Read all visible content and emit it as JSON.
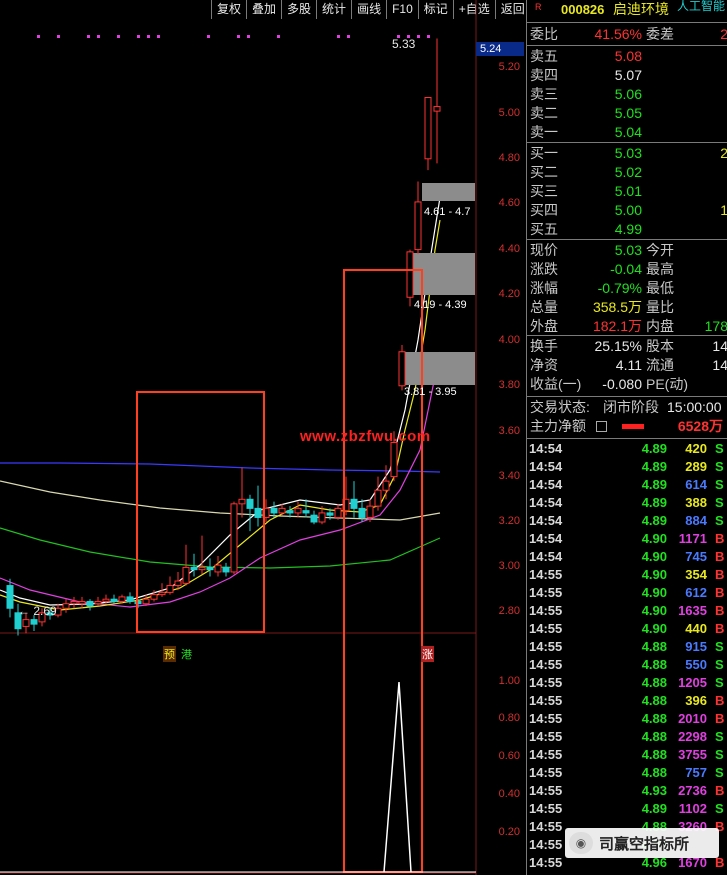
{
  "toolbar": {
    "items": [
      "复权",
      "叠加",
      "多股",
      "统计",
      "画线",
      "F10",
      "标记",
      "+自选",
      "返回"
    ]
  },
  "stock": {
    "flag": "R",
    "code": "000826",
    "name": "启迪环境",
    "extra": "人工智能"
  },
  "price_axis": {
    "current": "5.24",
    "ticks": [
      "5.20",
      "5.00",
      "4.80",
      "4.60",
      "4.40",
      "4.20",
      "4.00",
      "3.80",
      "3.60",
      "3.40",
      "3.20",
      "3.00",
      "2.80"
    ],
    "sub_ticks": [
      "1.00",
      "0.80",
      "0.60",
      "0.40",
      "0.20"
    ]
  },
  "chart_labels": {
    "high_mark": "5.33",
    "low_mark": "2.69",
    "range1": "4.61 - 4.7",
    "range2": "4.19 - 4.39",
    "range3": "3.81 - 3.95",
    "tag1": "预",
    "tag2": "港",
    "tag3": "涨",
    "site_watermark": "www.zbzfwu.com"
  },
  "quote": {
    "weibi_label": "委比",
    "weibi": "41.56%",
    "weicha_label": "委差",
    "weicha": "2",
    "asks": [
      {
        "label": "卖五",
        "price": "5.08",
        "vol": ""
      },
      {
        "label": "卖四",
        "price": "5.07",
        "vol": ""
      },
      {
        "label": "卖三",
        "price": "5.06",
        "vol": ""
      },
      {
        "label": "卖二",
        "price": "5.05",
        "vol": ""
      },
      {
        "label": "卖一",
        "price": "5.04",
        "vol": ""
      }
    ],
    "bids": [
      {
        "label": "买一",
        "price": "5.03",
        "vol": "2"
      },
      {
        "label": "买二",
        "price": "5.02",
        "vol": ""
      },
      {
        "label": "买三",
        "price": "5.01",
        "vol": ""
      },
      {
        "label": "买四",
        "price": "5.00",
        "vol": "1"
      },
      {
        "label": "买五",
        "price": "4.99",
        "vol": ""
      }
    ],
    "stats": [
      {
        "l1": "现价",
        "v1": "5.03",
        "l2": "今开",
        "v2": ""
      },
      {
        "l1": "涨跌",
        "v1": "-0.04",
        "l2": "最高",
        "v2": ""
      },
      {
        "l1": "涨幅",
        "v1": "-0.79%",
        "l2": "最低",
        "v2": ""
      },
      {
        "l1": "总量",
        "v1": "358.5万",
        "l2": "量比",
        "v2": ""
      },
      {
        "l1": "外盘",
        "v1": "182.1万",
        "l2": "内盘",
        "v2": "178"
      }
    ],
    "stats2": [
      {
        "l1": "换手",
        "v1": "25.15%",
        "l2": "股本",
        "v2": "14"
      },
      {
        "l1": "净资",
        "v1": "4.11",
        "l2": "流通",
        "v2": "14"
      },
      {
        "l1": "收益(一)",
        "v1": "-0.080",
        "l2": "PE(动)",
        "v2": ""
      }
    ],
    "status_label": "交易状态:",
    "status_value": "闭市阶段",
    "status_time": "15:00:00",
    "main_net_label": "主力净额",
    "main_net_value": "6528万"
  },
  "trades": [
    {
      "time": "14:54",
      "price": "4.89",
      "vol": "420",
      "dir": "S"
    },
    {
      "time": "14:54",
      "price": "4.89",
      "vol": "289",
      "dir": "S"
    },
    {
      "time": "14:54",
      "price": "4.89",
      "vol": "614",
      "dir": "S"
    },
    {
      "time": "14:54",
      "price": "4.89",
      "vol": "388",
      "dir": "S"
    },
    {
      "time": "14:54",
      "price": "4.89",
      "vol": "884",
      "dir": "S"
    },
    {
      "time": "14:54",
      "price": "4.90",
      "vol": "1171",
      "dir": "B"
    },
    {
      "time": "14:54",
      "price": "4.90",
      "vol": "745",
      "dir": "B"
    },
    {
      "time": "14:55",
      "price": "4.90",
      "vol": "354",
      "dir": "B"
    },
    {
      "time": "14:55",
      "price": "4.90",
      "vol": "612",
      "dir": "B"
    },
    {
      "time": "14:55",
      "price": "4.90",
      "vol": "1635",
      "dir": "B"
    },
    {
      "time": "14:55",
      "price": "4.90",
      "vol": "440",
      "dir": "B"
    },
    {
      "time": "14:55",
      "price": "4.88",
      "vol": "915",
      "dir": "S"
    },
    {
      "time": "14:55",
      "price": "4.88",
      "vol": "550",
      "dir": "S"
    },
    {
      "time": "14:55",
      "price": "4.88",
      "vol": "1205",
      "dir": "S"
    },
    {
      "time": "14:55",
      "price": "4.88",
      "vol": "396",
      "dir": "B"
    },
    {
      "time": "14:55",
      "price": "4.88",
      "vol": "2010",
      "dir": "B"
    },
    {
      "time": "14:55",
      "price": "4.88",
      "vol": "2298",
      "dir": "S"
    },
    {
      "time": "14:55",
      "price": "4.88",
      "vol": "3755",
      "dir": "S"
    },
    {
      "time": "14:55",
      "price": "4.88",
      "vol": "757",
      "dir": "S"
    },
    {
      "time": "14:55",
      "price": "4.93",
      "vol": "2736",
      "dir": "B"
    },
    {
      "time": "14:55",
      "price": "4.89",
      "vol": "1102",
      "dir": "S"
    },
    {
      "time": "14:55",
      "price": "4.88",
      "vol": "3260",
      "dir": "B"
    },
    {
      "time": "14:55",
      "price": "4.90",
      "vol": "",
      "dir": ""
    },
    {
      "time": "14:55",
      "price": "4.96",
      "vol": "1670",
      "dir": "B"
    }
  ],
  "brand_watermark": "司赢空指标所",
  "colors": {
    "up": "#ff3232",
    "down": "#20d0d0",
    "frame": "#ff4020"
  }
}
